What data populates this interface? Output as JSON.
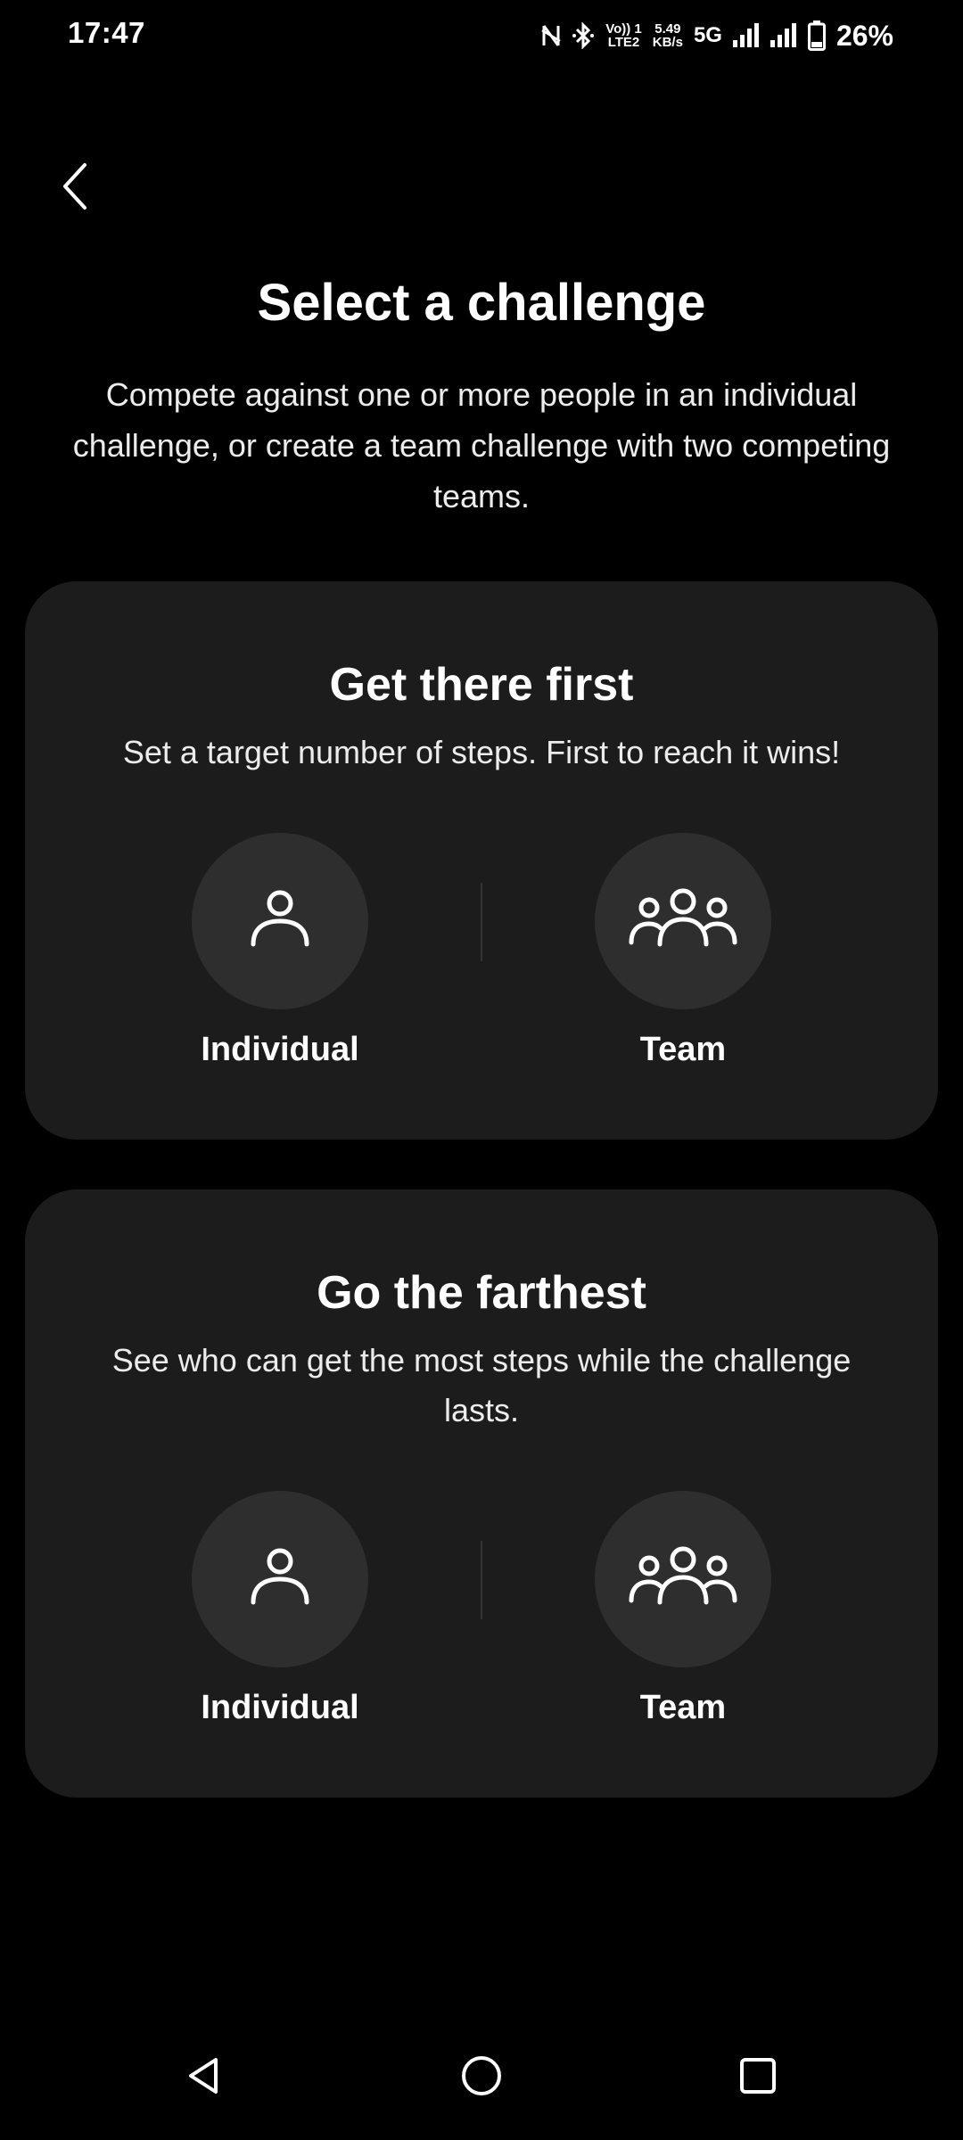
{
  "status_bar": {
    "time": "17:47",
    "volte_top": "Vo)) 1",
    "volte_bottom": "LTE2",
    "speed_value": "5.49",
    "speed_unit": "KB/s",
    "network": "5G",
    "battery": "26%"
  },
  "header": {
    "back_icon": "chevron-left-icon",
    "title": "Select a challenge",
    "description": "Compete against one or more people in an individual challenge, or create a team challenge with two competing teams."
  },
  "cards": [
    {
      "title": "Get there first",
      "description": "Set a target number of steps. First to reach it wins!",
      "options": [
        {
          "label": "Individual",
          "icon": "person-icon"
        },
        {
          "label": "Team",
          "icon": "group-icon"
        }
      ]
    },
    {
      "title": "Go the farthest",
      "description": "See who can get the most steps while the challenge lasts.",
      "options": [
        {
          "label": "Individual",
          "icon": "person-icon"
        },
        {
          "label": "Team",
          "icon": "group-icon"
        }
      ]
    }
  ],
  "colors": {
    "background": "#000000",
    "card": "#1c1c1c",
    "circle": "#2e2e2e",
    "text": "#ffffff"
  }
}
